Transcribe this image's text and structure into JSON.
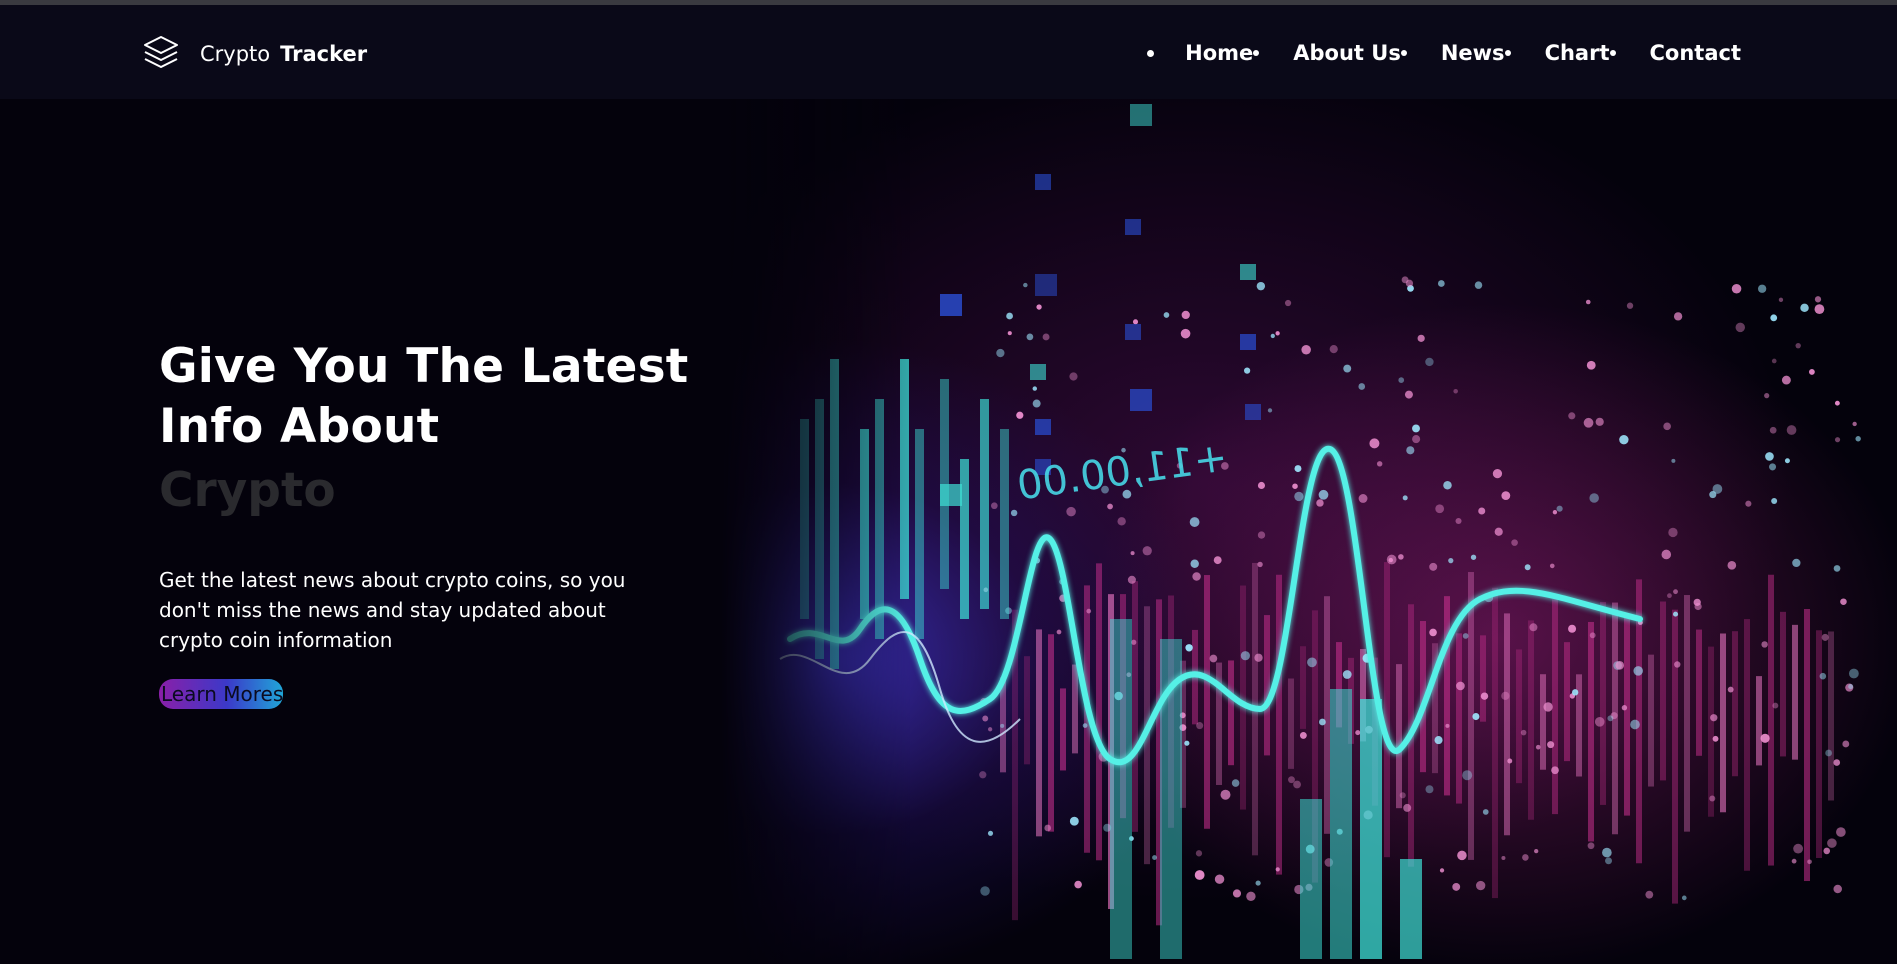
{
  "brand": {
    "light": "Crypto",
    "bold": "Tracker",
    "logo_icon": "layers-icon"
  },
  "nav": {
    "items": [
      {
        "label": "Home"
      },
      {
        "label": "About Us"
      },
      {
        "label": "News"
      },
      {
        "label": "Chart"
      },
      {
        "label": "Contact"
      }
    ]
  },
  "hero": {
    "title_line1": "Give You The Latest",
    "title_line2": "Info About",
    "rotating_word": "Crypto",
    "description": "Get the latest news about crypto coins, so you don't miss the news and stay updated about crypto coin information",
    "cta_label": "Learn Mores",
    "art_readout": "+11,00.00"
  },
  "colors": {
    "background": "#04020c",
    "header": "#0a0918",
    "accent_cyan": "#3ee0d6",
    "accent_magenta": "#d23c9a",
    "accent_blue": "#3b39c9"
  }
}
